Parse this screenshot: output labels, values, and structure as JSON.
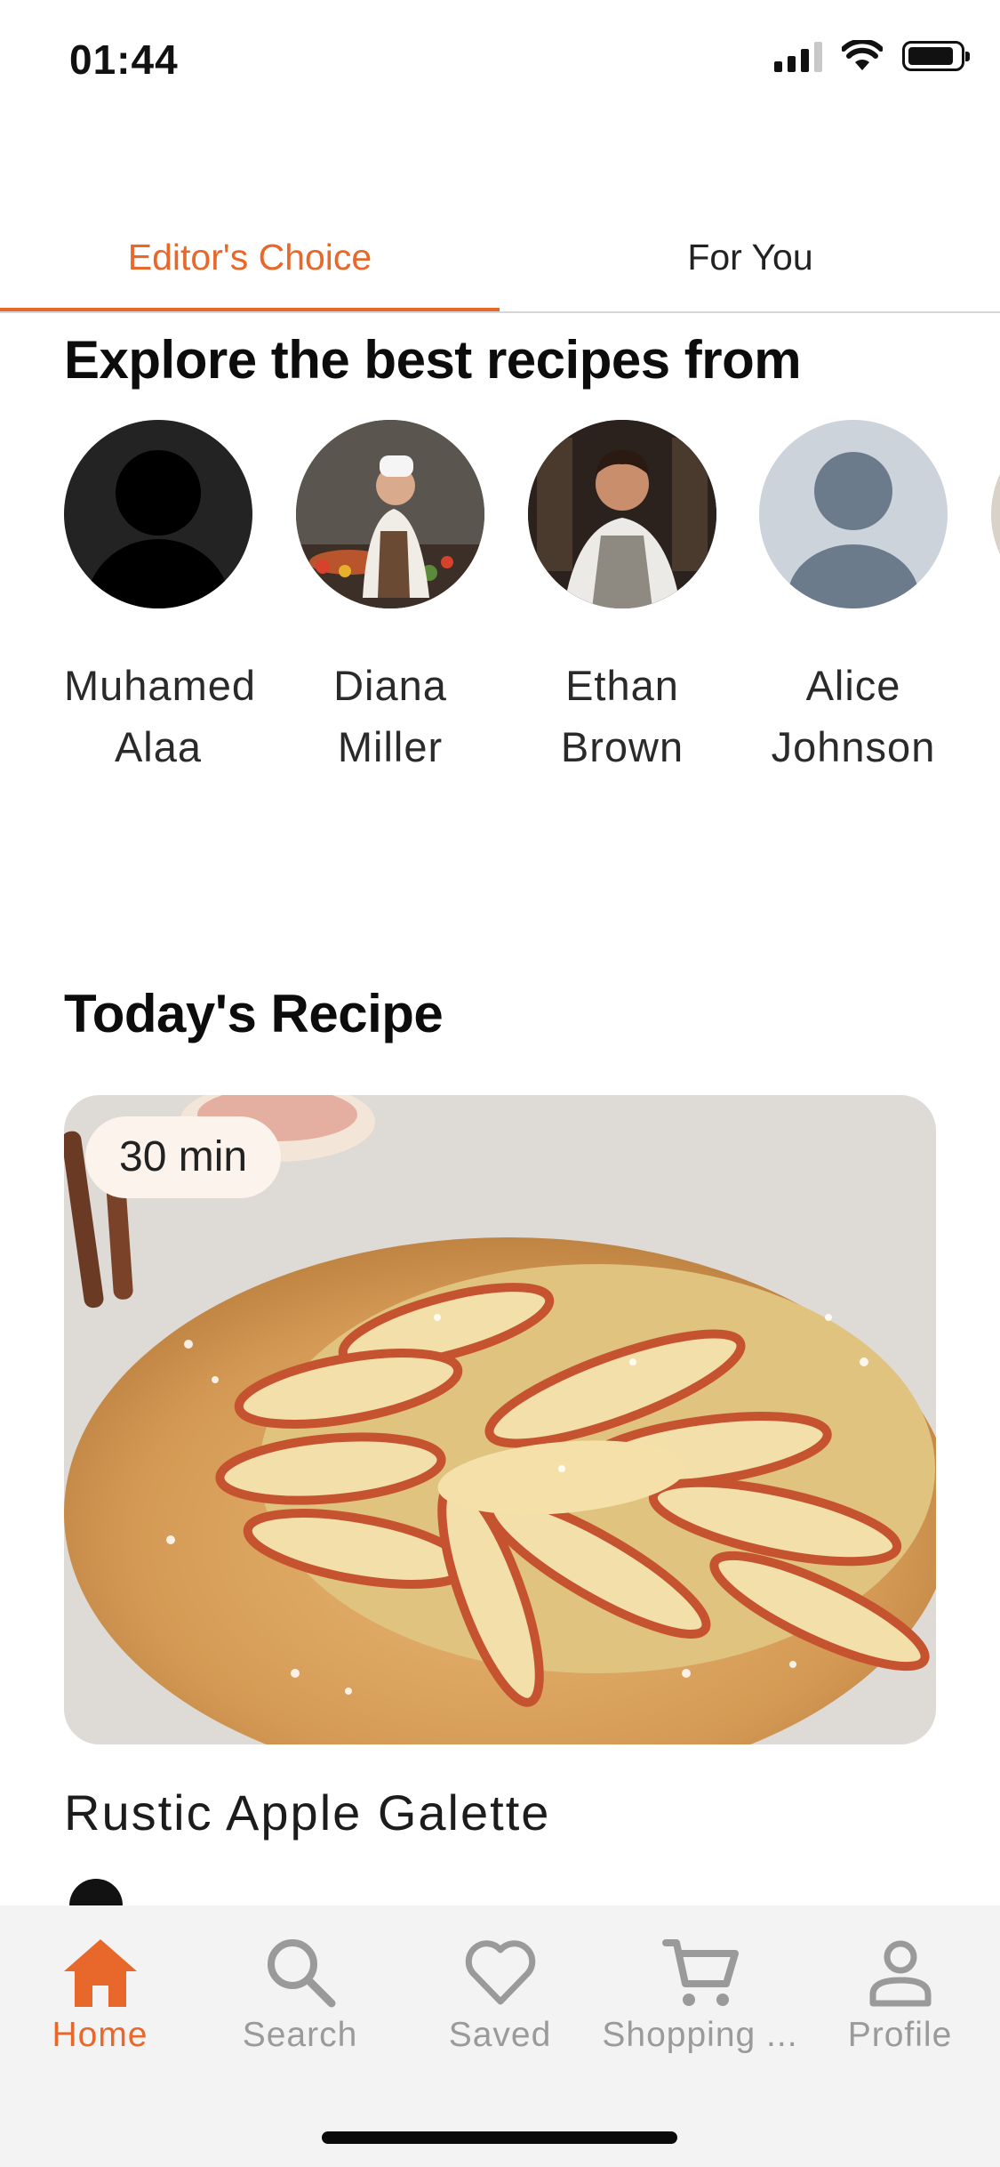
{
  "status_bar": {
    "time": "01:44"
  },
  "tabs": [
    {
      "label": "Editor's Choice",
      "active": true
    },
    {
      "label": "For You",
      "active": false
    }
  ],
  "explore": {
    "title": "Explore the best recipes from",
    "chefs": [
      {
        "name": "Muhamed Alaa",
        "avatar": "placeholder-dark"
      },
      {
        "name": "Diana Miller",
        "avatar": "photo"
      },
      {
        "name": "Ethan Brown",
        "avatar": "photo"
      },
      {
        "name": "Alice Johnson",
        "avatar": "placeholder-gray"
      }
    ]
  },
  "today": {
    "title": "Today's Recipe",
    "recipe": {
      "time_badge": "30 min",
      "name": "Rustic Apple Galette"
    }
  },
  "nav": {
    "items": [
      {
        "label": "Home",
        "icon": "home-icon",
        "active": true
      },
      {
        "label": "Search",
        "icon": "search-icon",
        "active": false
      },
      {
        "label": "Saved",
        "icon": "heart-icon",
        "active": false
      },
      {
        "label": "Shopping ...",
        "icon": "cart-icon",
        "active": false
      },
      {
        "label": "Profile",
        "icon": "person-icon",
        "active": false
      }
    ]
  },
  "colors": {
    "accent": "#e8672a",
    "nav_bg": "#f3f3f3",
    "inactive": "#9a9a9a"
  }
}
